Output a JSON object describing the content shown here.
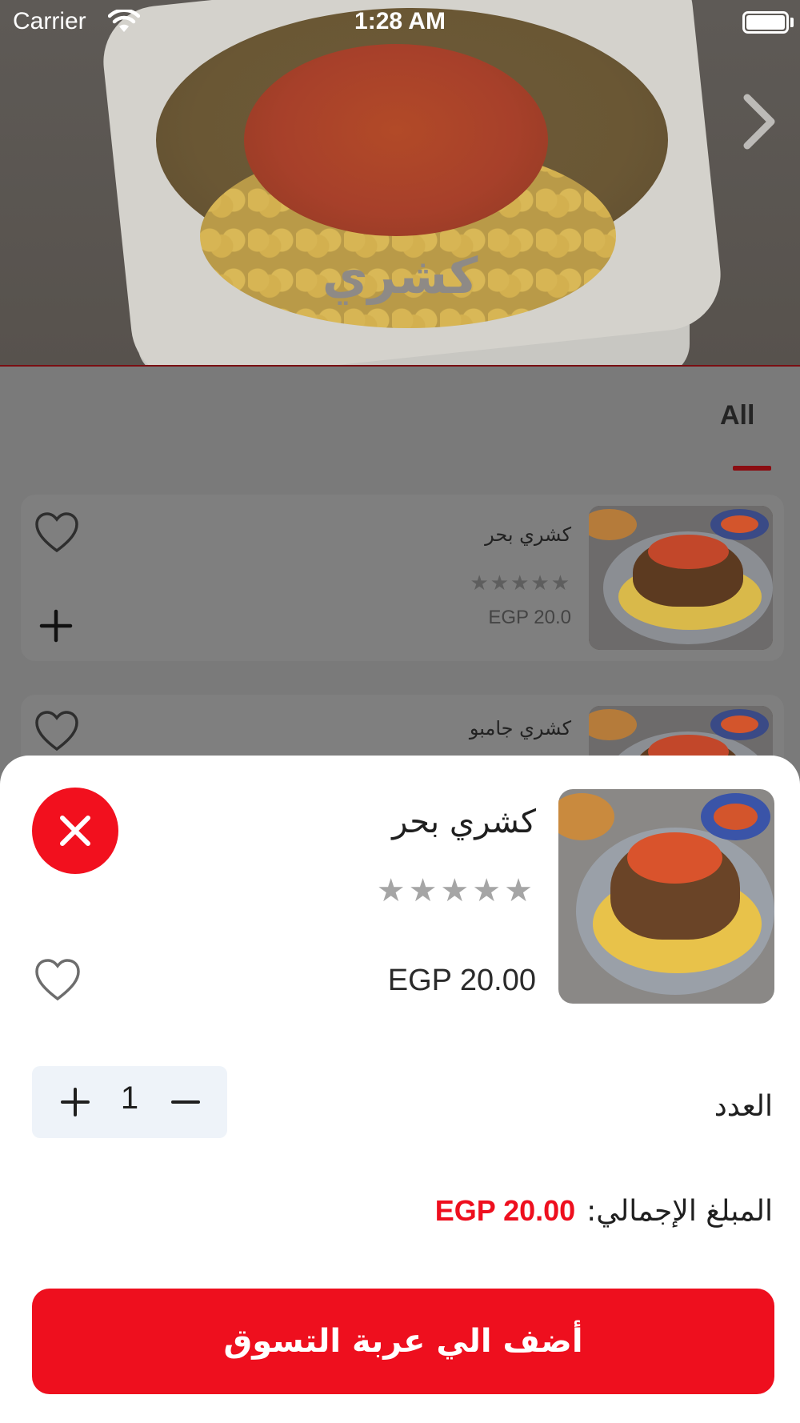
{
  "status_bar": {
    "carrier": "Carrier",
    "time": "1:28 AM"
  },
  "hero": {
    "title": "كشري"
  },
  "tabs": [
    {
      "label": "All",
      "selected": true
    }
  ],
  "list": [
    {
      "name": "كشري بحر",
      "rating_stars": "★★★★★",
      "price": "EGP 20.0"
    },
    {
      "name": "كشري جامبو"
    }
  ],
  "sheet": {
    "item_name": "كشري بحر",
    "rating_stars": "★★★★★",
    "price": "EGP 20.00",
    "quantity_label": "العدد",
    "quantity_value": "1",
    "total_label": "المبلغ الإجمالي:",
    "total_value": "EGP 20.00",
    "add_to_cart_label": "أضف الي عربة التسوق"
  },
  "colors": {
    "accent_red": "#ee0f1e",
    "tab_indicator": "#8b0d12",
    "stepper_bg": "#eef3f9"
  },
  "icons": [
    "wifi-icon",
    "battery-icon",
    "chevron-right-icon",
    "heart-outline-icon",
    "plus-icon",
    "close-icon",
    "minus-icon",
    "star-icon"
  ]
}
